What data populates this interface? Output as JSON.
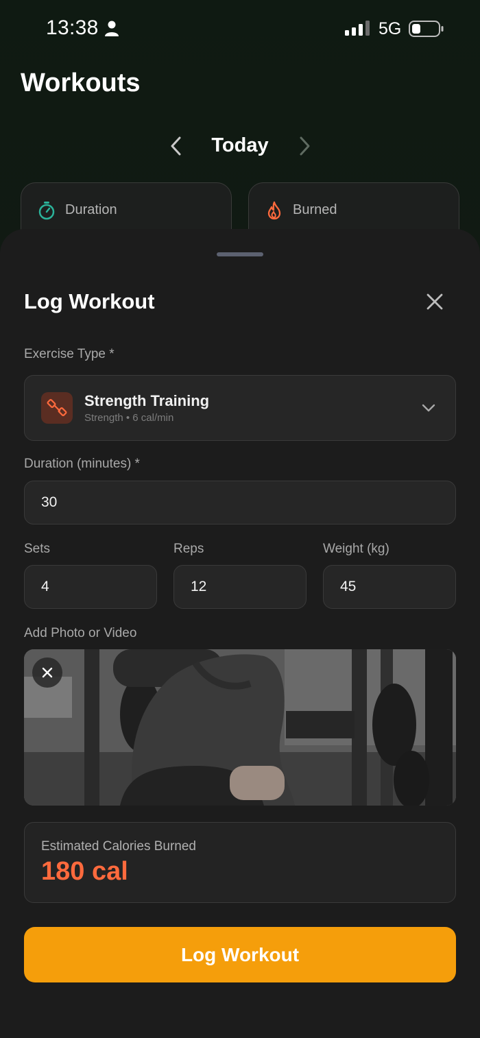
{
  "status_bar": {
    "time": "13:38",
    "network": "5G"
  },
  "header": {
    "title": "Workouts"
  },
  "date_nav": {
    "label": "Today"
  },
  "stats": {
    "duration_label": "Duration",
    "burned_label": "Burned"
  },
  "sheet": {
    "title": "Log Workout",
    "exercise_type": {
      "label": "Exercise Type *",
      "selected_name": "Strength Training",
      "selected_meta": "Strength • 6 cal/min"
    },
    "duration": {
      "label": "Duration (minutes) *",
      "value": "30"
    },
    "sets": {
      "label": "Sets",
      "value": "4"
    },
    "reps": {
      "label": "Reps",
      "value": "12"
    },
    "weight": {
      "label": "Weight (kg)",
      "value": "45"
    },
    "media": {
      "label": "Add Photo or Video"
    },
    "calories": {
      "label": "Estimated Calories Burned",
      "value": "180 cal"
    },
    "submit_label": "Log Workout"
  },
  "colors": {
    "accent": "#f59e0b",
    "calorie": "#ff6a3d",
    "timer_icon": "#2bb39a",
    "flame_icon": "#ff6a3d"
  }
}
